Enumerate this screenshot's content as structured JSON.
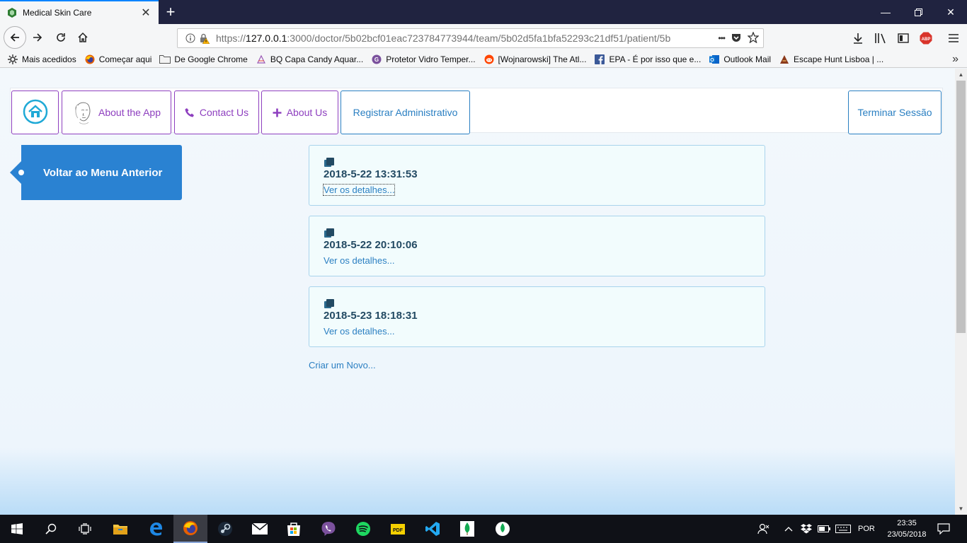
{
  "browser": {
    "tab_title": "Medical Skin Care",
    "url_prefix": "https://",
    "url_host": "127.0.0.1",
    "url_rest": ":3000/doctor/5b02bcf01eac723784773944/team/5b02d5fa1bfa52293c21df51/patient/5b",
    "url_ellipsis": "•••"
  },
  "bookmarks": [
    {
      "label": "Mais acedidos",
      "icon": "gear-icon"
    },
    {
      "label": "Começar aqui",
      "icon": "firefox-icon"
    },
    {
      "label": "De Google Chrome",
      "icon": "folder-icon"
    },
    {
      "label": "BQ Capa Candy Aquar...",
      "icon": "shop-icon"
    },
    {
      "label": "Protetor Vidro Temper...",
      "icon": "viber-icon"
    },
    {
      "label": "[Wojnarowski] The Atl...",
      "icon": "reddit-icon"
    },
    {
      "label": "EPA - É por isso que e...",
      "icon": "facebook-icon"
    },
    {
      "label": "Outlook Mail",
      "icon": "outlook-icon"
    },
    {
      "label": "Escape Hunt Lisboa | ...",
      "icon": "escape-icon"
    }
  ],
  "app_nav": {
    "about_app": "About the App",
    "contact": "Contact Us",
    "about_us": "About Us",
    "register_admin": "Registrar Administrativo",
    "logout": "Terminar Sessão"
  },
  "sidebar": {
    "back_label": "Voltar ao Menu Anterior"
  },
  "consultations": [
    {
      "date": "2018-5-22 13:31:53",
      "link": "Ver os detalhes..."
    },
    {
      "date": "2018-5-22 20:10:06",
      "link": "Ver os detalhes..."
    },
    {
      "date": "2018-5-23 18:18:31",
      "link": "Ver os detalhes..."
    }
  ],
  "create_new": "Criar um Novo...",
  "taskbar": {
    "language": "POR",
    "time": "23:35",
    "date": "23/05/2018"
  },
  "colors": {
    "accent_purple": "#8e3fbf",
    "accent_blue": "#2a7fc2",
    "sidebar_blue": "#2a82d2",
    "card_border": "#a9d4ec"
  }
}
